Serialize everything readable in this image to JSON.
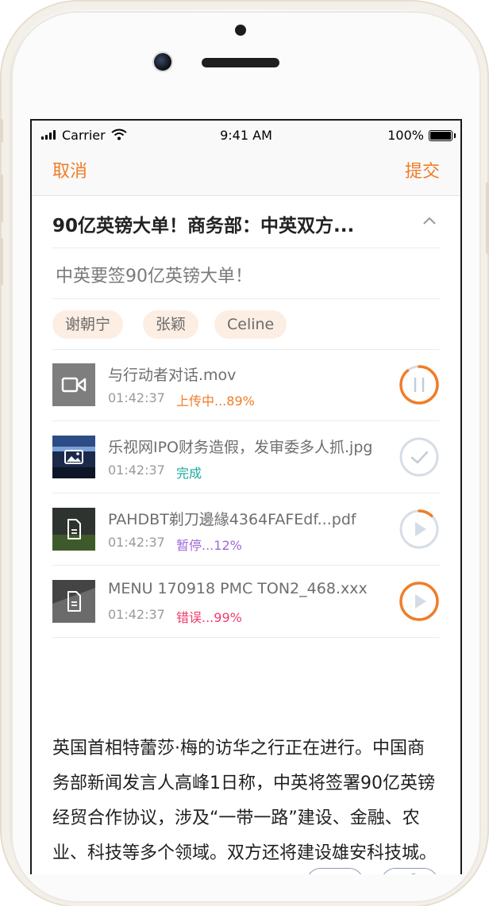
{
  "status_bar": {
    "carrier": "Carrier",
    "time": "9:41 AM",
    "battery": "100%"
  },
  "nav": {
    "cancel": "取消",
    "submit": "提交"
  },
  "title": "90亿英镑大单！商务部：中英双方...",
  "subtitle": "中英要签90亿英镑大单！",
  "tags": [
    "谢朝宁",
    "张颖",
    "Celine"
  ],
  "files": [
    {
      "name": "与行动者对话.mov",
      "time": "01:42:37",
      "status": "上传中...89%",
      "status_color": "#f07d28",
      "progress": 0.89,
      "state": "uploading"
    },
    {
      "name": "乐视网IPO财务造假，发审委多人抓.jpg",
      "time": "01:42:37",
      "status": "完成",
      "status_color": "#1aab9b",
      "progress": 1.0,
      "state": "done"
    },
    {
      "name": "PAHDBT剃刀邊緣4364FAFEdf...pdf",
      "time": "01:42:37",
      "status": "暂停...12%",
      "status_color": "#a069d6",
      "progress": 0.12,
      "state": "paused"
    },
    {
      "name": "MENU 170918 PMC TON2_468.xxx",
      "time": "01:42:37",
      "status": "错误...99%",
      "status_color": "#ef3d6b",
      "progress": 0.99,
      "state": "error"
    }
  ],
  "body_text": "英国首相特蕾莎·梅的访华之行正在进行。中国商务部新闻发言人高峰1日称，中英将签署90亿英镑经贸合作协议，涉及“一带一路”建设、金融、农业、科技等多个领域。双方还将建设雄安科技城。",
  "colors": {
    "accent": "#f07d28",
    "ring_track": "#d7dde6",
    "icon_blue": "#8b98b8"
  }
}
